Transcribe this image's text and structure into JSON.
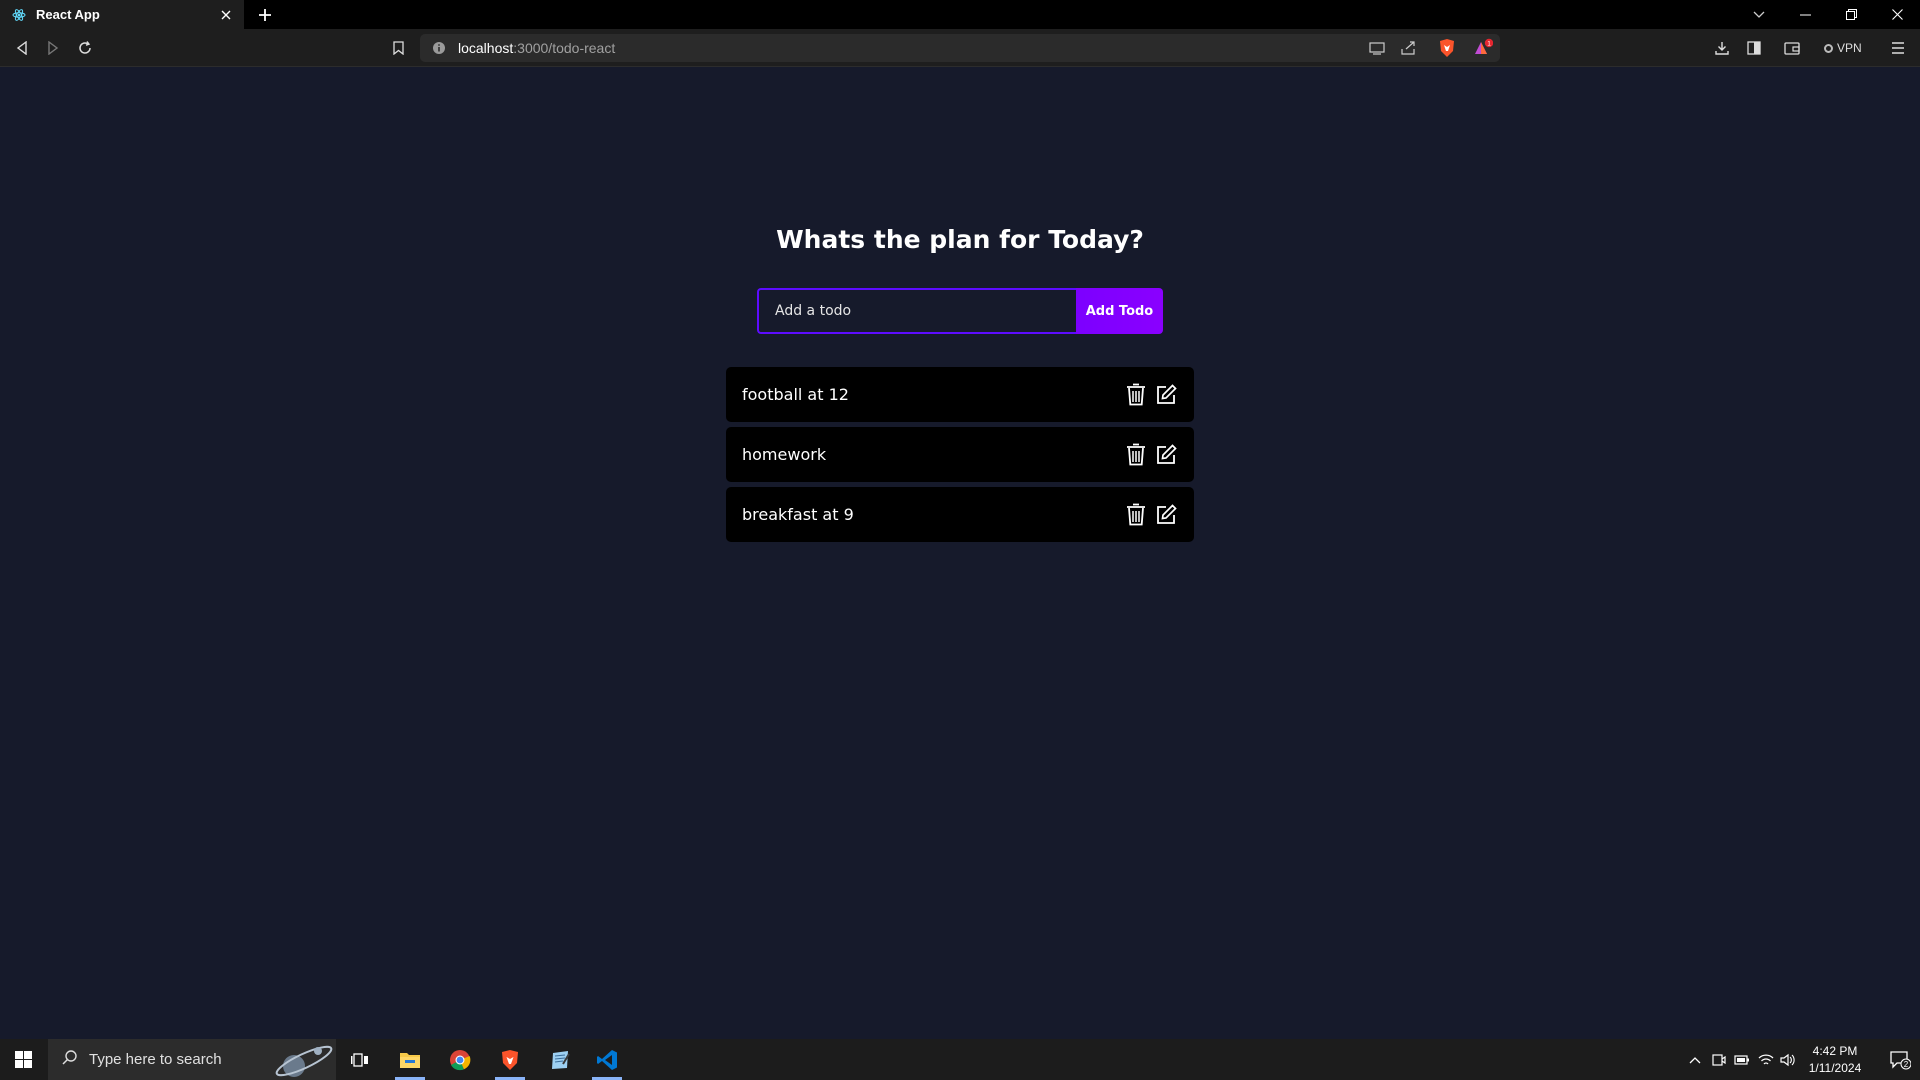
{
  "browser": {
    "tab_title": "React App",
    "url_host": "localhost",
    "url_path": ":3000/todo-react",
    "vpn_label": "VPN",
    "rewards_badge": "1"
  },
  "app": {
    "heading": "Whats the plan for Today?",
    "input_placeholder": "Add a todo",
    "input_value": "",
    "add_button_label": "Add Todo",
    "accent_color": "#5d0cff",
    "button_color": "#7c00ff",
    "background_color": "#161a2b",
    "todos": [
      {
        "text": "football at 12"
      },
      {
        "text": "homework"
      },
      {
        "text": "breakfast at 9"
      }
    ]
  },
  "taskbar": {
    "search_placeholder": "Type here to search",
    "time": "4:42 PM",
    "date": "1/11/2024",
    "notification_count": "2",
    "apps": [
      "task-view-icon",
      "file-explorer-icon",
      "chrome-icon",
      "brave-icon",
      "notepad-icon",
      "vscode-icon"
    ]
  }
}
